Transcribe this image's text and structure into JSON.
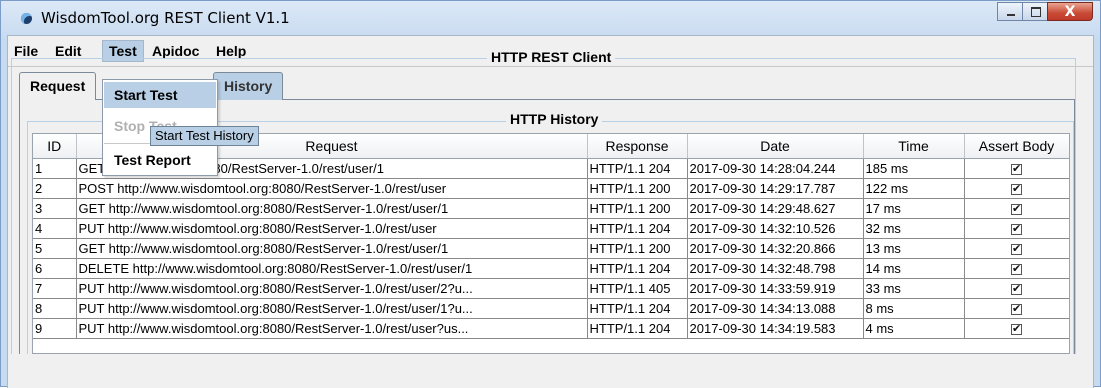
{
  "window": {
    "title": "WisdomTool.org REST Client V1.1",
    "close_label": "X"
  },
  "menubar": {
    "items": [
      "File",
      "Edit",
      "Test",
      "Apidoc",
      "Help"
    ],
    "active": "Test"
  },
  "test_menu": {
    "items": [
      {
        "label": "Start Test",
        "state": "highlighted"
      },
      {
        "label": "Stop Test",
        "state": "disabled"
      },
      {
        "label": "Test Report",
        "state": "normal"
      }
    ]
  },
  "tooltip": "Start Test History",
  "panel_title": "HTTP REST Client",
  "tabs": [
    "Request",
    "History"
  ],
  "history": {
    "title": "HTTP History",
    "columns": [
      "ID",
      "Request",
      "Response",
      "Date",
      "Time",
      "Assert Body"
    ],
    "rows": [
      {
        "id": "1",
        "request": "GET http://127.0.0.1:8080/RestServer-1.0/rest/user/1",
        "response": "HTTP/1.1 204",
        "date": "2017-09-30 14:28:04.244",
        "time": "185 ms",
        "assert": true
      },
      {
        "id": "2",
        "request": "POST http://www.wisdomtool.org:8080/RestServer-1.0/rest/user",
        "response": "HTTP/1.1 200",
        "date": "2017-09-30 14:29:17.787",
        "time": "122 ms",
        "assert": true
      },
      {
        "id": "3",
        "request": "GET http://www.wisdomtool.org:8080/RestServer-1.0/rest/user/1",
        "response": "HTTP/1.1 200",
        "date": "2017-09-30 14:29:48.627",
        "time": "17 ms",
        "assert": true
      },
      {
        "id": "4",
        "request": "PUT http://www.wisdomtool.org:8080/RestServer-1.0/rest/user",
        "response": "HTTP/1.1 204",
        "date": "2017-09-30 14:32:10.526",
        "time": "32 ms",
        "assert": true
      },
      {
        "id": "5",
        "request": "GET http://www.wisdomtool.org:8080/RestServer-1.0/rest/user/1",
        "response": "HTTP/1.1 200",
        "date": "2017-09-30 14:32:20.866",
        "time": "13 ms",
        "assert": true
      },
      {
        "id": "6",
        "request": "DELETE http://www.wisdomtool.org:8080/RestServer-1.0/rest/user/1",
        "response": "HTTP/1.1 204",
        "date": "2017-09-30 14:32:48.798",
        "time": "14 ms",
        "assert": true
      },
      {
        "id": "7",
        "request": "PUT http://www.wisdomtool.org:8080/RestServer-1.0/rest/user/2?u...",
        "response": "HTTP/1.1 405",
        "date": "2017-09-30 14:33:59.919",
        "time": "33 ms",
        "assert": true
      },
      {
        "id": "8",
        "request": "PUT http://www.wisdomtool.org:8080/RestServer-1.0/rest/user/1?u...",
        "response": "HTTP/1.1 204",
        "date": "2017-09-30 14:34:13.088",
        "time": "8 ms",
        "assert": true
      },
      {
        "id": "9",
        "request": "PUT http://www.wisdomtool.org:8080/RestServer-1.0/rest/user?us...",
        "response": "HTTP/1.1 204",
        "date": "2017-09-30 14:34:19.583",
        "time": "4 ms",
        "assert": true
      }
    ]
  }
}
